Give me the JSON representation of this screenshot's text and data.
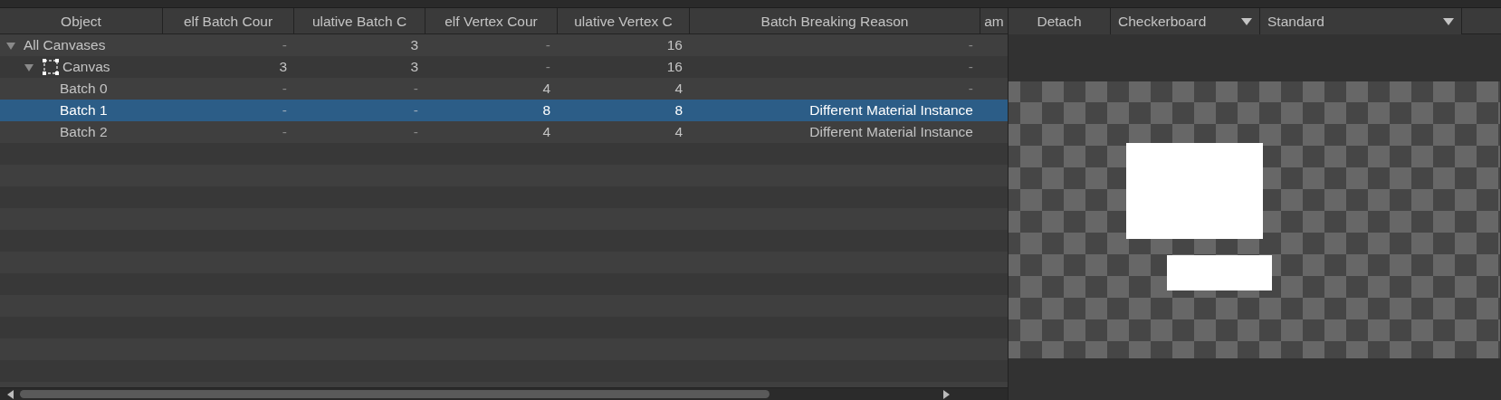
{
  "table": {
    "columns": [
      "Object",
      "elf Batch Cour",
      "ulative Batch C",
      "elf Vertex Cour",
      "ulative Vertex C",
      "Batch Breaking Reason",
      "am"
    ],
    "rows": [
      {
        "name": "All Canvases",
        "expanded": true,
        "selected": false,
        "cells": [
          "-",
          "3",
          "-",
          "16",
          "-"
        ],
        "children": [
          {
            "name": "Canvas",
            "expanded": true,
            "selected": false,
            "kind": "canvas",
            "cells": [
              "3",
              "3",
              "-",
              "16",
              "-"
            ],
            "children": [
              {
                "name": "Batch 0",
                "selected": false,
                "cells": [
                  "-",
                  "-",
                  "4",
                  "4",
                  "-"
                ]
              },
              {
                "name": "Batch 1",
                "selected": true,
                "cells": [
                  "-",
                  "-",
                  "8",
                  "8",
                  "Different Material Instance"
                ]
              },
              {
                "name": "Batch 2",
                "selected": false,
                "cells": [
                  "-",
                  "-",
                  "4",
                  "4",
                  "Different Material Instance"
                ]
              }
            ]
          }
        ]
      }
    ]
  },
  "toolbar": {
    "button": "Detach",
    "background_dropdown": "Checkerboard",
    "mode_dropdown": "Standard"
  }
}
